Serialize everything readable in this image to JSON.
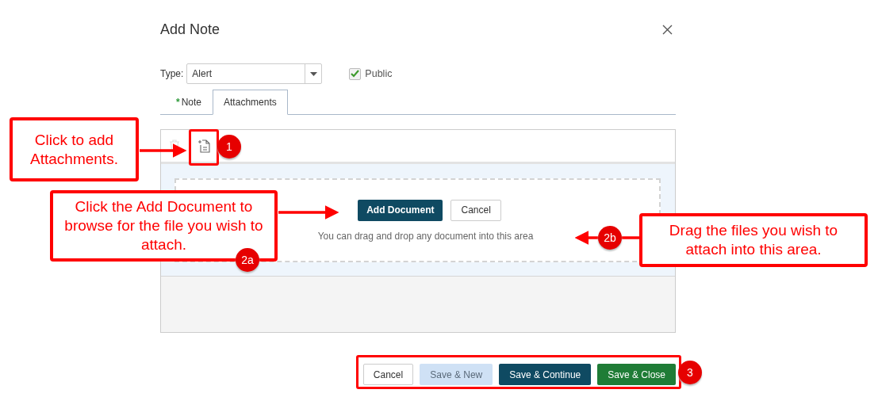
{
  "dialog": {
    "title": "Add Note",
    "type_label": "Type:",
    "type_value": "Alert",
    "public": {
      "label": "Public",
      "checked": true
    },
    "tabs": [
      {
        "marker": "*",
        "label": "Note",
        "selected": false
      },
      {
        "label": "Attachments",
        "selected": true
      }
    ],
    "toolbar": [
      {
        "kind": "delete",
        "disabled": true
      },
      {
        "kind": "add",
        "disabled": false
      }
    ],
    "drop_zone": {
      "add_button": "Add Document",
      "cancel_button": "Cancel",
      "hint": "You can drag and drop any document into this area"
    },
    "footer": [
      {
        "label": "Cancel",
        "kind": "secondary",
        "disabled": false
      },
      {
        "label": "Save & New",
        "kind": "primary",
        "disabled": true
      },
      {
        "label": "Save & Continue",
        "kind": "primary",
        "disabled": false
      },
      {
        "label": "Save & Close",
        "kind": "success",
        "disabled": false
      }
    ]
  },
  "annotations": [
    {
      "badge": "1",
      "text": "Click to add Attachments."
    },
    {
      "badge": "2a",
      "text": "Click the Add Document to browse for the file you wish to attach."
    },
    {
      "badge": "2b",
      "text": "Drag the files you wish to attach into this area."
    },
    {
      "badge": "3"
    }
  ]
}
